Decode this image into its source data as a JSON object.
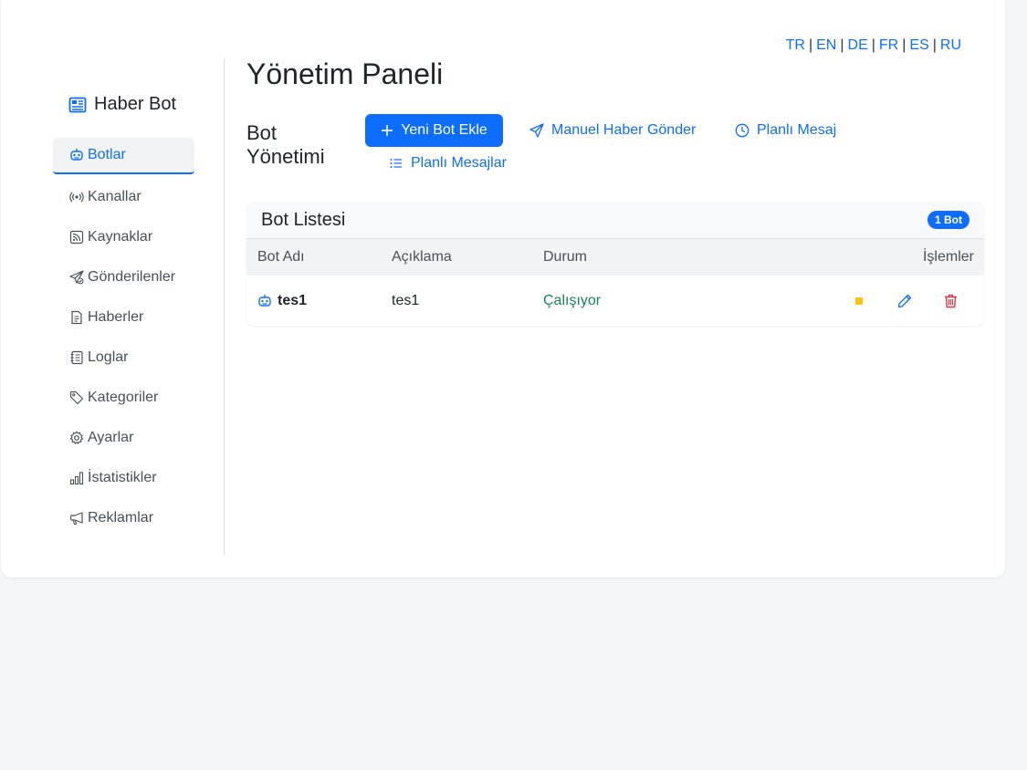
{
  "languages": [
    "TR",
    "EN",
    "DE",
    "FR",
    "ES",
    "RU"
  ],
  "brand": {
    "title": "Haber Bot",
    "icon": "newspaper-icon"
  },
  "sidebar": {
    "items": [
      {
        "label": "Botlar",
        "icon": "robot-icon",
        "active": true
      },
      {
        "label": "Kanallar",
        "icon": "broadcast-icon"
      },
      {
        "label": "Kaynaklar",
        "icon": "rss-icon"
      },
      {
        "label": "Gönderilenler",
        "icon": "send-check-icon"
      },
      {
        "label": "Haberler",
        "icon": "file-text-icon"
      },
      {
        "label": "Loglar",
        "icon": "journal-icon"
      },
      {
        "label": "Kategoriler",
        "icon": "tags-icon"
      },
      {
        "label": "Ayarlar",
        "icon": "gear-icon"
      },
      {
        "label": "İstatistikler",
        "icon": "bar-chart-icon"
      },
      {
        "label": "Reklamlar",
        "icon": "megaphone-icon"
      }
    ]
  },
  "main": {
    "title": "Yönetim Paneli",
    "section_title": "Bot Yönetimi",
    "actions": {
      "add_bot": "Yeni Bot Ekle",
      "manual_news": "Manuel Haber Gönder",
      "scheduled_message": "Planlı Mesaj",
      "scheduled_messages": "Planlı Mesajlar"
    }
  },
  "bot_list": {
    "title": "Bot Listesi",
    "badge": "1 Bot",
    "columns": {
      "name": "Bot Adı",
      "description": "Açıklama",
      "status": "Durum",
      "actions": "İşlemler"
    },
    "rows": [
      {
        "name": "tes1",
        "description": "tes1",
        "status": "Çalışıyor"
      }
    ]
  },
  "colors": {
    "primary": "#0d6efd",
    "success": "#198754",
    "warning": "#ffc107",
    "danger": "#dc3545"
  }
}
